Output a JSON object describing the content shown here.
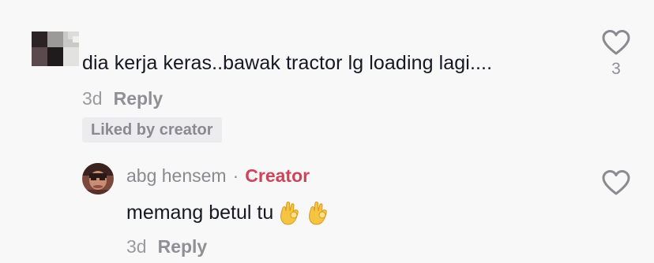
{
  "comment": {
    "text": "dia kerja keras..bawak tractor lg loading lagi....",
    "time": "3d",
    "reply_label": "Reply",
    "liked_badge": "Liked by creator",
    "like_count": "3",
    "avatar_icon": "pixelated-avatar-icon",
    "like_icon": "heart-outline-icon"
  },
  "reply": {
    "username": "abg hensem",
    "separator": "·",
    "creator_label": "Creator",
    "text": "memang betul tu",
    "emojis": [
      "ok-hand-emoji",
      "ok-hand-emoji"
    ],
    "time": "3d",
    "reply_label": "Reply",
    "avatar_icon": "profile-photo-avatar",
    "like_icon": "heart-outline-icon"
  },
  "colors": {
    "background": "#f8f8f8",
    "text_primary": "#161823",
    "text_secondary": "#8a8a90",
    "creator_accent": "#d0435a",
    "badge_bg": "#ececee"
  }
}
